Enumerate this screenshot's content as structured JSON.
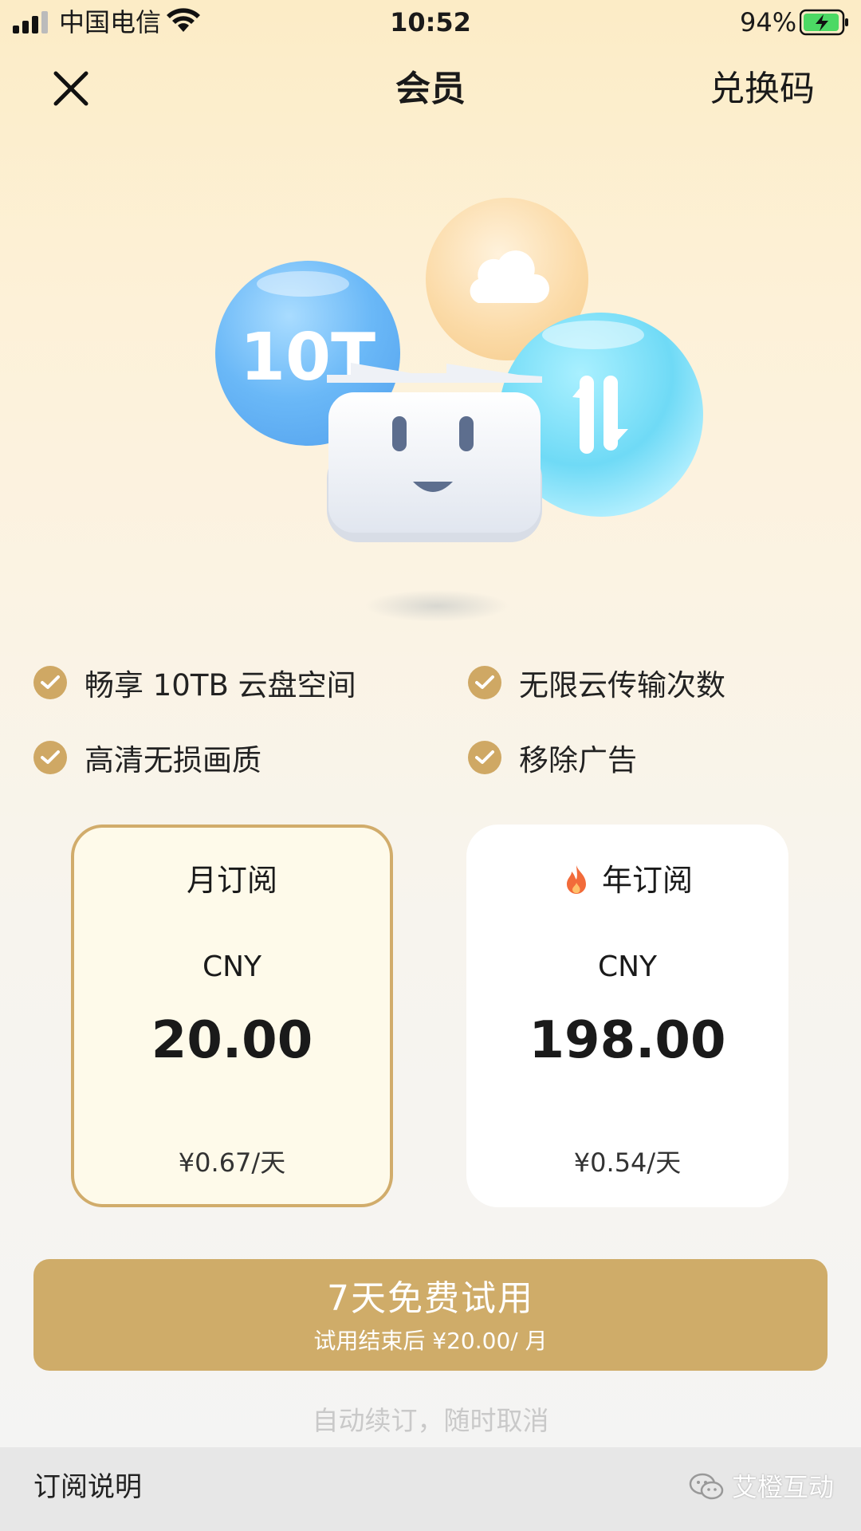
{
  "status_bar": {
    "carrier": "中国电信",
    "time": "10:52",
    "battery": "94%"
  },
  "header": {
    "title": "会员",
    "redeem_label": "兑换码"
  },
  "hero": {
    "storage_badge": "10T"
  },
  "features": [
    {
      "label": "畅享 10TB 云盘空间"
    },
    {
      "label": "无限云传输次数"
    },
    {
      "label": "高清无损画质"
    },
    {
      "label": "移除广告"
    }
  ],
  "plans": [
    {
      "name": "月订阅",
      "currency": "CNY",
      "price": "20.00",
      "daily": "¥0.67/天",
      "selected": true
    },
    {
      "name": "年订阅",
      "currency": "CNY",
      "price": "198.00",
      "daily": "¥0.54/天",
      "selected": false,
      "hot": true
    }
  ],
  "cta": {
    "main": "7天免费试用",
    "sub": "试用结束后 ¥20.00/ 月"
  },
  "auto_renew_note": "自动续订，随时取消",
  "footer": {
    "label": "订阅说明",
    "watermark": "艾橙互动"
  },
  "colors": {
    "accent": "#cfac69",
    "selected_border": "#d1ac6b",
    "battery_fill": "#4cd964"
  }
}
